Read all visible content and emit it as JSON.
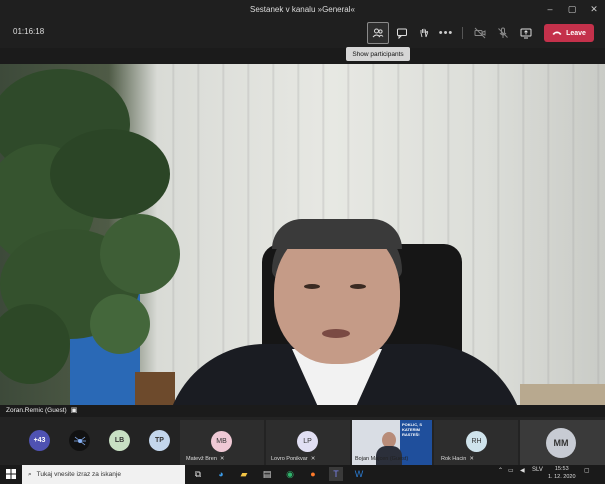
{
  "window": {
    "title": "Sestanek v kanalu »General«",
    "controls": [
      "–",
      "▢",
      "✕"
    ]
  },
  "toolbar": {
    "timer": "01:16:18",
    "leave_label": "Leave",
    "tooltip": "Show participants"
  },
  "video": {
    "speaker_name": "Zoran.Remic (Guest)"
  },
  "participants": {
    "overflow_count": "+43",
    "initials": [
      "LB",
      "TP"
    ],
    "tiles": [
      {
        "initials": "MB",
        "name": "Matevž Bren"
      },
      {
        "initials": "LP",
        "name": "Lovro Ponikvar"
      },
      {
        "initials": "",
        "name": "Bojan Majcen (Guest)"
      },
      {
        "initials": "RH",
        "name": "Rok Hacin"
      }
    ],
    "big_avatar": "MM",
    "video_tile_text": "POKLIC, S KATERIM RASTEŠ!"
  },
  "taskbar": {
    "search_placeholder": "Tukaj vnesite izraz za iskanje",
    "language": "SLV",
    "time": "15:53",
    "date": "1. 12. 2020"
  },
  "colors": {
    "leave": "#c4314b",
    "toolbar": "#1f1f1f",
    "taskbar": "#1a1a1a"
  }
}
